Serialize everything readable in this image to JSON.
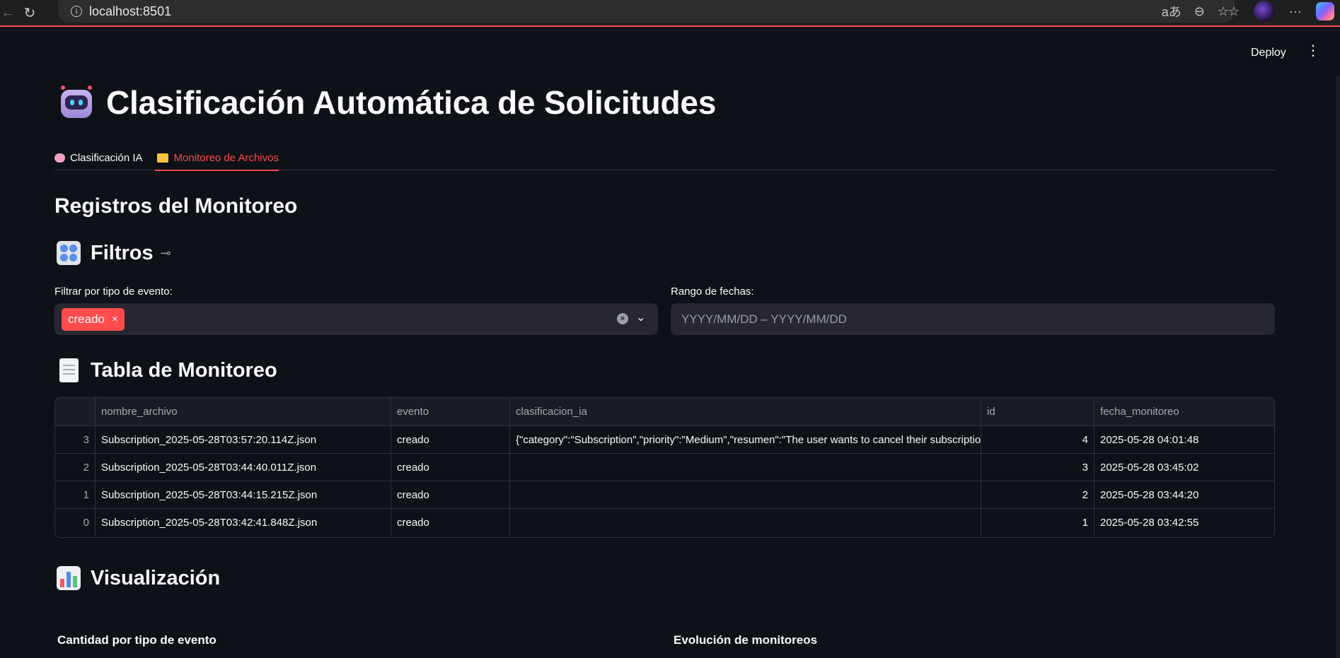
{
  "browser": {
    "url": "localhost:8501",
    "icons": [
      "back-icon",
      "reload-icon",
      "info-icon",
      "translate-icon",
      "zoom-out-icon",
      "favorite-icon",
      "favorites-list-icon",
      "profile-avatar",
      "more-icon",
      "copilot-icon"
    ],
    "translate_glyph": "aあ",
    "more_glyph": "···"
  },
  "app_header": {
    "deploy_label": "Deploy",
    "menu_glyph": "⋮"
  },
  "page": {
    "title": "Clasificación Automática de Solicitudes",
    "tabs": [
      {
        "label": "Clasificación IA",
        "icon": "brain-icon",
        "active": false
      },
      {
        "label": "Monitoreo de Archivos",
        "icon": "folder-icon",
        "active": true
      }
    ],
    "section_title": "Registros del Monitoreo"
  },
  "filters": {
    "heading": "Filtros",
    "event_label": "Filtrar por tipo de evento:",
    "event_chip": "creado",
    "chip_remove": "×",
    "date_label": "Rango de fechas:",
    "date_placeholder": "YYYY/MM/DD – YYYY/MM/DD"
  },
  "table": {
    "heading": "Tabla de Monitoreo",
    "columns": [
      "",
      "nombre_archivo",
      "evento",
      "clasificacion_ia",
      "id",
      "fecha_monitoreo"
    ],
    "rows": [
      {
        "index": "3",
        "nombre_archivo": "Subscription_2025-05-28T03:57:20.114Z.json",
        "evento": "creado",
        "clasificacion_ia": "{\"category\":\"Subscription\",\"priority\":\"Medium\",\"resumen\":\"The user wants to cancel their subscriptio",
        "id": "4",
        "fecha_monitoreo": "2025-05-28 04:01:48"
      },
      {
        "index": "2",
        "nombre_archivo": "Subscription_2025-05-28T03:44:40.011Z.json",
        "evento": "creado",
        "clasificacion_ia": "",
        "id": "3",
        "fecha_monitoreo": "2025-05-28 03:45:02"
      },
      {
        "index": "1",
        "nombre_archivo": "Subscription_2025-05-28T03:44:15.215Z.json",
        "evento": "creado",
        "clasificacion_ia": "",
        "id": "2",
        "fecha_monitoreo": "2025-05-28 03:44:20"
      },
      {
        "index": "0",
        "nombre_archivo": "Subscription_2025-05-28T03:42:41.848Z.json",
        "evento": "creado",
        "clasificacion_ia": "",
        "id": "1",
        "fecha_monitoreo": "2025-05-28 03:42:55"
      }
    ]
  },
  "visualization": {
    "heading": "Visualización",
    "chart_left_title": "Cantidad por tipo de evento",
    "chart_right_title": "Evolución de monitoreos"
  },
  "colors": {
    "background": "#0e1117",
    "accent": "#ff4b4b",
    "input_bg": "#262730",
    "border": "#31333f"
  }
}
